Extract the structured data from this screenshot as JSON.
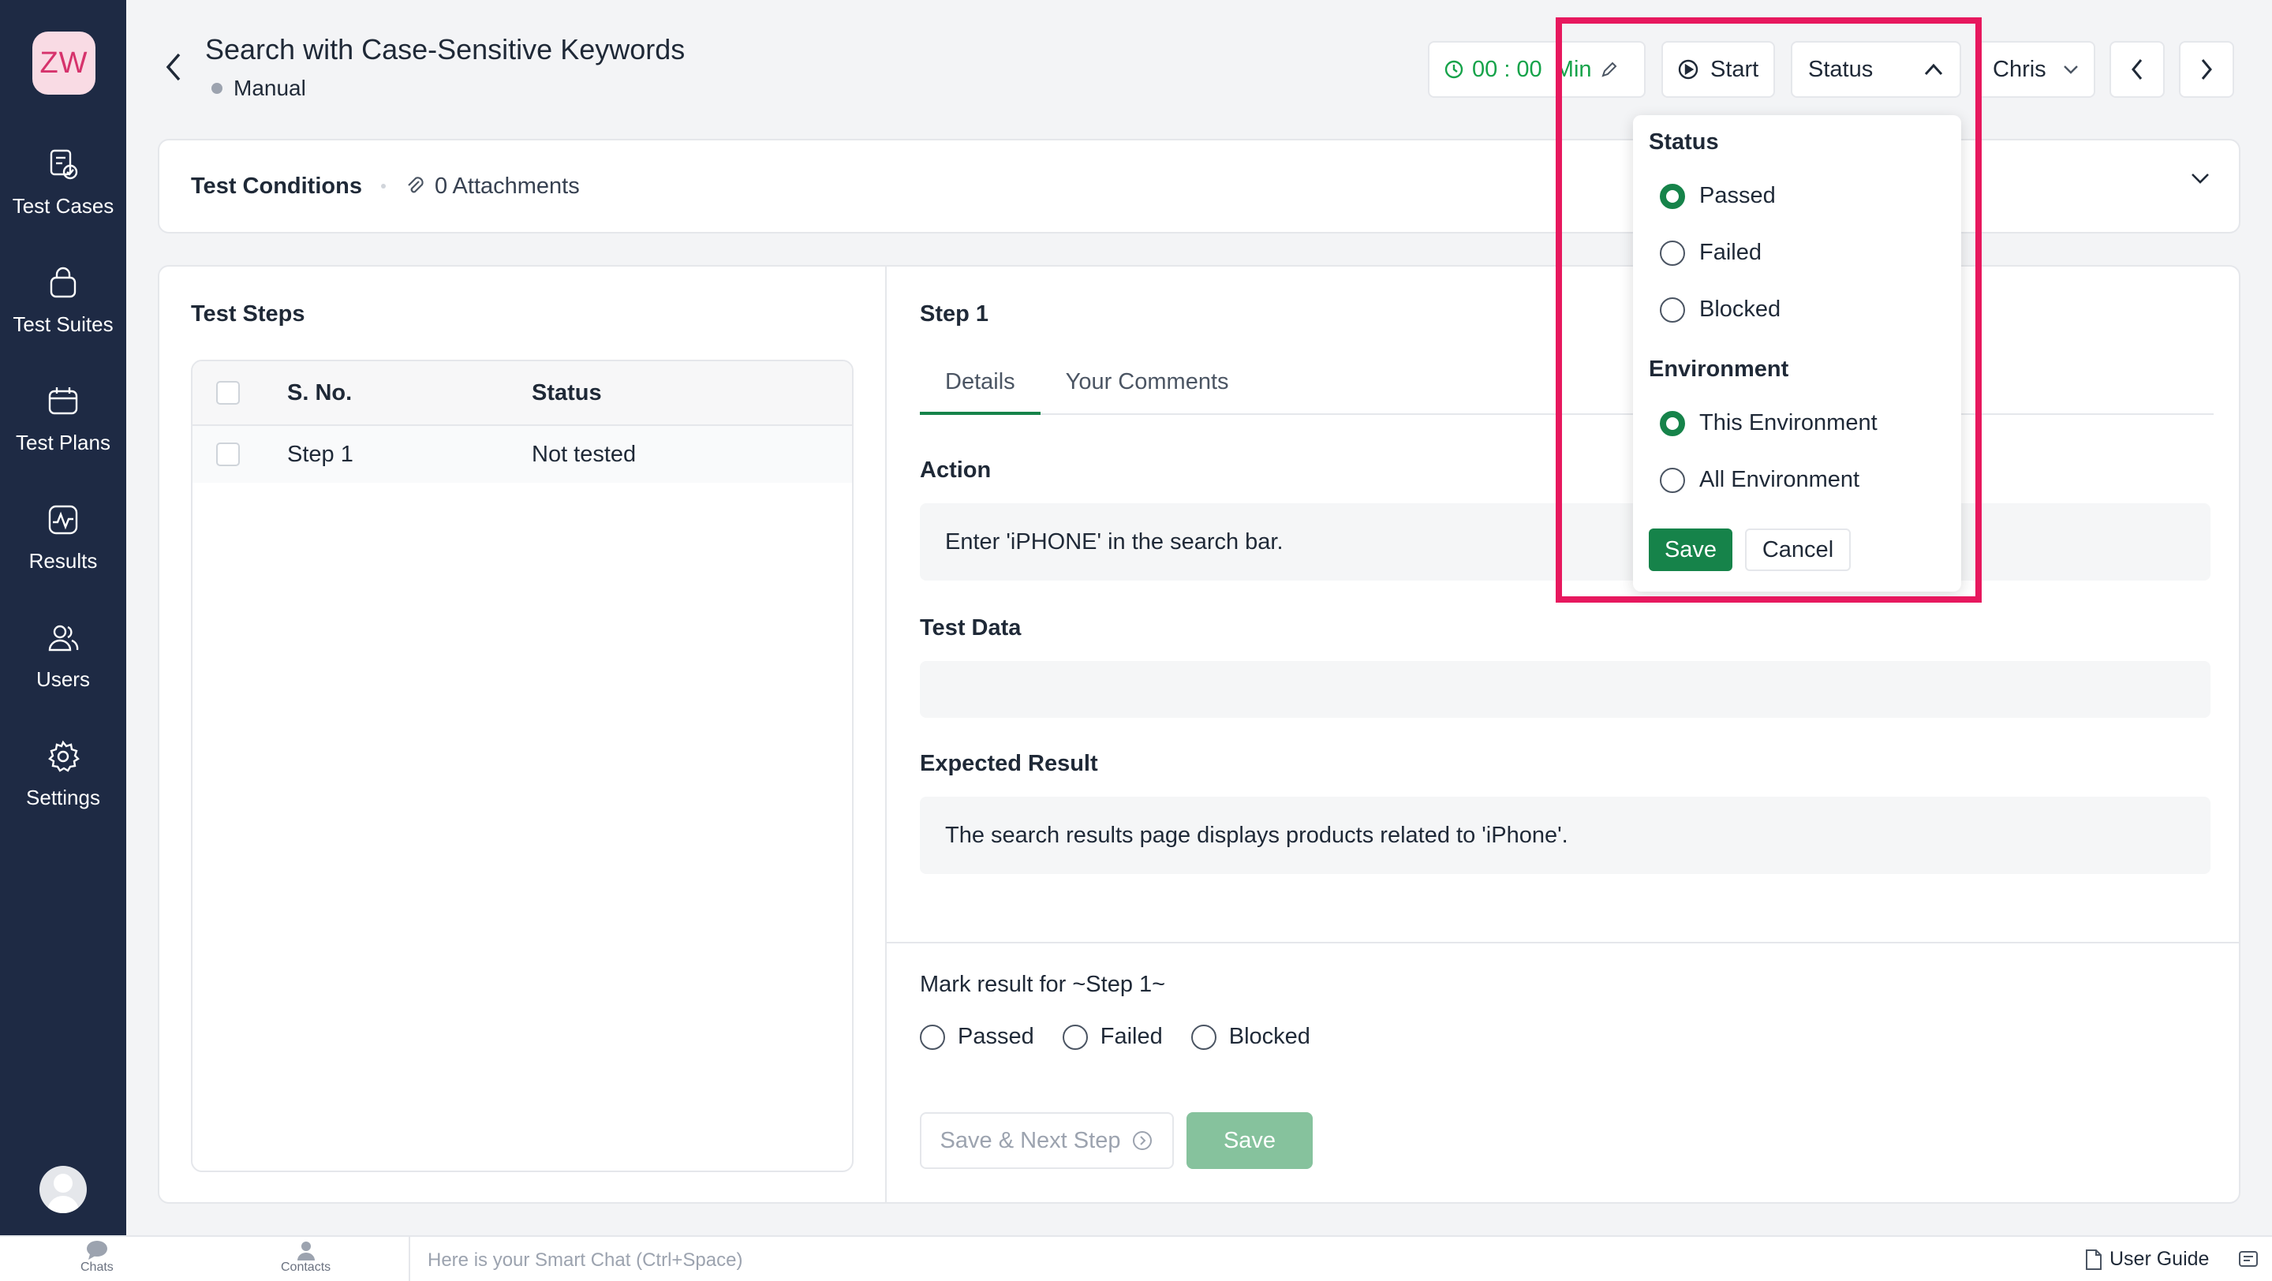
{
  "logo": {
    "text": "ZW"
  },
  "sidebar": {
    "items": [
      {
        "label": "Test Cases",
        "icon": "test-cases-icon"
      },
      {
        "label": "Test Suites",
        "icon": "test-suites-icon"
      },
      {
        "label": "Test Plans",
        "icon": "test-plans-icon"
      },
      {
        "label": "Results",
        "icon": "results-icon"
      },
      {
        "label": "Users",
        "icon": "users-icon"
      },
      {
        "label": "Settings",
        "icon": "settings-icon"
      }
    ]
  },
  "header": {
    "title": "Search with Case-Sensitive Keywords",
    "type": "Manual",
    "timer": "00 : 00  Min",
    "start_label": "Start",
    "status_label": "Status",
    "assignee": "Chris"
  },
  "conditions": {
    "label": "Test Conditions",
    "attachments": "0 Attachments"
  },
  "steps_panel": {
    "title": "Test Steps",
    "columns": [
      "S. No.",
      "Status"
    ],
    "rows": [
      {
        "sno": "Step 1",
        "status": "Not tested"
      }
    ]
  },
  "detail": {
    "step_title": "Step 1",
    "tabs": [
      "Details",
      "Your Comments"
    ],
    "action_label": "Action",
    "action_value": "Enter 'iPHONE' in the search bar.",
    "test_data_label": "Test Data",
    "test_data_value": "",
    "expected_label": "Expected Result",
    "expected_value": "The search results page displays products related to 'iPhone'.",
    "mark_title": "Mark result for ~Step 1~",
    "mark_options": [
      "Passed",
      "Failed",
      "Blocked"
    ],
    "save_next_label": "Save & Next Step",
    "save_label": "Save"
  },
  "dropdown": {
    "status_heading": "Status",
    "status_options": [
      "Passed",
      "Failed",
      "Blocked"
    ],
    "status_selected": "Passed",
    "env_heading": "Environment",
    "env_options": [
      "This Environment",
      "All Environment"
    ],
    "env_selected": "This Environment",
    "save_label": "Save",
    "cancel_label": "Cancel"
  },
  "bottombar": {
    "chats": "Chats",
    "contacts": "Contacts",
    "chat_placeholder": "Here is your Smart Chat (Ctrl+Space)",
    "user_guide": "User Guide"
  },
  "colors": {
    "sidebar_bg": "#1e2a44",
    "accent_green": "#16834a",
    "timer_green": "#16a34a",
    "highlight": "#e7185e"
  }
}
